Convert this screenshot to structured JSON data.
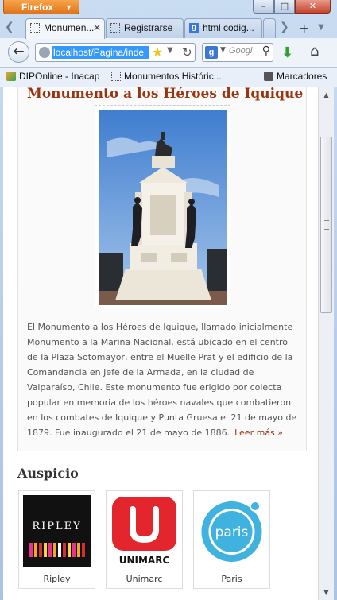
{
  "browser": {
    "app_button": "Firefox",
    "tabs": [
      {
        "title": "Monumen...",
        "active": true
      },
      {
        "title": "Registrarse",
        "active": false
      },
      {
        "title": "html codig...",
        "active": false
      }
    ],
    "url": "localhost/Pagina/inde",
    "search_placeholder": "Googl",
    "bookmarks": [
      "DIPOnline - Inacap",
      "Monumentos Históric...",
      "Marcadores"
    ]
  },
  "page": {
    "monument_title": "Monumento a los Héroes de Iquique",
    "description": "El Monumento a los Héroes de Iquique, llamado inicialmente Monumento a la Marina Nacional, está ubicado en el centro de la Plaza Sotomayor, entre el Muelle Prat y el edificio de la Comandancia en Jefe de la Armada, en la ciudad de Valparaíso, Chile. Este monumento fue erigido por colecta popular en memoria de los héroes navales que combatieron en los combates de Iquique y Punta Gruesa el 21 de mayo de 1879. Fue inaugurado el 21 de mayo de 1886.",
    "read_more": "Leer más »",
    "sponsors_heading": "Auspicio",
    "sponsors": [
      {
        "name": "Ripley",
        "logo_text": "RIPLEY"
      },
      {
        "name": "Unimarc",
        "logo_text": "UNIMARC"
      },
      {
        "name": "Paris",
        "logo_text": "paris"
      }
    ]
  },
  "colors": {
    "accent": "#9a3512",
    "unimarc_red": "#e3262d",
    "paris_blue": "#3fb2e0"
  }
}
